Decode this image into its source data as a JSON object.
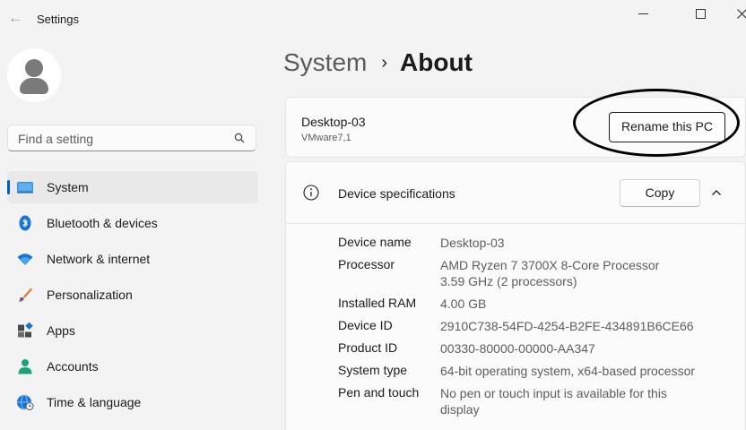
{
  "window": {
    "title": "Settings"
  },
  "sidebar": {
    "search_placeholder": "Find a setting",
    "items": [
      {
        "label": "System",
        "icon": "system-icon",
        "active": true
      },
      {
        "label": "Bluetooth & devices",
        "icon": "bluetooth-icon"
      },
      {
        "label": "Network & internet",
        "icon": "wifi-icon"
      },
      {
        "label": "Personalization",
        "icon": "brush-icon"
      },
      {
        "label": "Apps",
        "icon": "apps-icon"
      },
      {
        "label": "Accounts",
        "icon": "person-icon"
      },
      {
        "label": "Time & language",
        "icon": "globe-clock-icon"
      }
    ]
  },
  "breadcrumb": {
    "parent": "System",
    "separator": "›",
    "current": "About"
  },
  "pc": {
    "name": "Desktop-03",
    "model": "VMware7,1",
    "rename_label": "Rename this PC"
  },
  "specs": {
    "title": "Device specifications",
    "copy_label": "Copy",
    "rows": [
      {
        "label": "Device name",
        "value": "Desktop-03"
      },
      {
        "label": "Processor",
        "value": "AMD Ryzen 7 3700X 8-Core Processor 3.59 GHz  (2 processors)"
      },
      {
        "label": "Installed RAM",
        "value": "4.00 GB"
      },
      {
        "label": "Device ID",
        "value": "2910C738-54FD-4254-B2FE-434891B6CE66"
      },
      {
        "label": "Product ID",
        "value": "00330-80000-00000-AA347"
      },
      {
        "label": "System type",
        "value": "64-bit operating system, x64-based processor"
      },
      {
        "label": "Pen and touch",
        "value": "No pen or touch input is available for this display"
      }
    ]
  },
  "colors": {
    "accent": "#005fb8",
    "background": "#f3f3f3",
    "card": "#fbfbfb"
  }
}
